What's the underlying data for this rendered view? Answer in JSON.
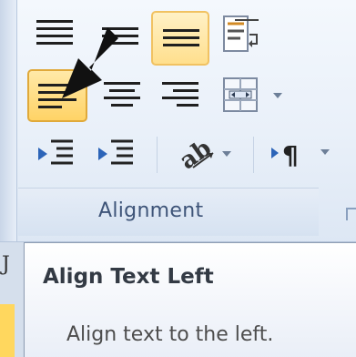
{
  "ribbon": {
    "group_label": "Alignment"
  },
  "tooltip": {
    "title": "Align Text Left",
    "description": "Align text to the left."
  },
  "doc": {
    "edge_glyph": "J"
  },
  "colors": {
    "active_fill": "#ffd366",
    "active_border": "#e0a93a",
    "label_text": "#3e5478"
  }
}
